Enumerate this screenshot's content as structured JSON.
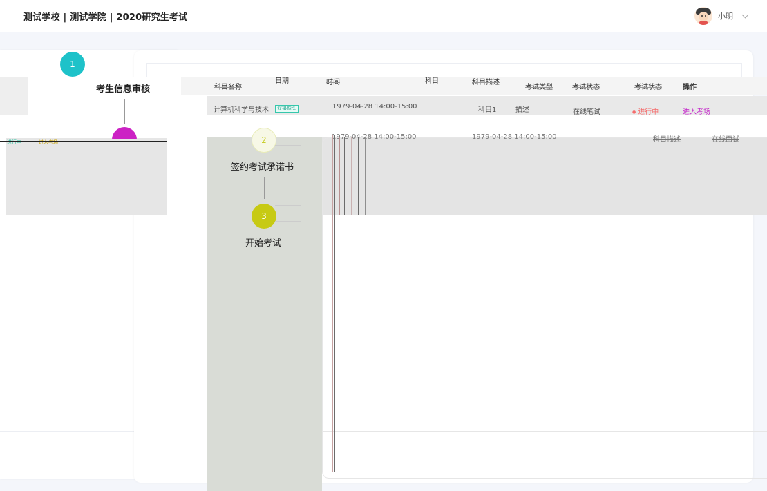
{
  "header": {
    "title": "测试学校 | 测试学院 | 2020研究生考试",
    "user_name": "小明"
  },
  "steps": [
    {
      "number": "1",
      "label": "考生信息审核"
    },
    {
      "number": "2",
      "label": "签约考试承诺书"
    },
    {
      "number": "3",
      "label": "开始考试"
    }
  ],
  "table": {
    "headers": [
      "科目名称",
      "日期",
      "时间",
      "科目",
      "科目描述",
      "考试类型",
      "考试状态",
      "操作"
    ],
    "row": {
      "name": "计算机科学与技术",
      "tag": "双摄像头",
      "datetime": "1979-04-28 14:00-15:00",
      "subject": "科目1",
      "description": "描述",
      "exam_type": "在线笔试",
      "status": "进行中",
      "action": "进入考场"
    },
    "row2": {
      "datetime": "1979-04-28 14:00-15:00",
      "subject": "科目描述",
      "exam_type": "在线面试"
    }
  },
  "glitch_left": {
    "status": "进行中",
    "action": "进入考场"
  },
  "colors": {
    "step1": "#1ec2c9",
    "step3": "#c7ca14",
    "status": "#f56c6c",
    "action": "#c321c9",
    "tag": "#35c7ac"
  }
}
